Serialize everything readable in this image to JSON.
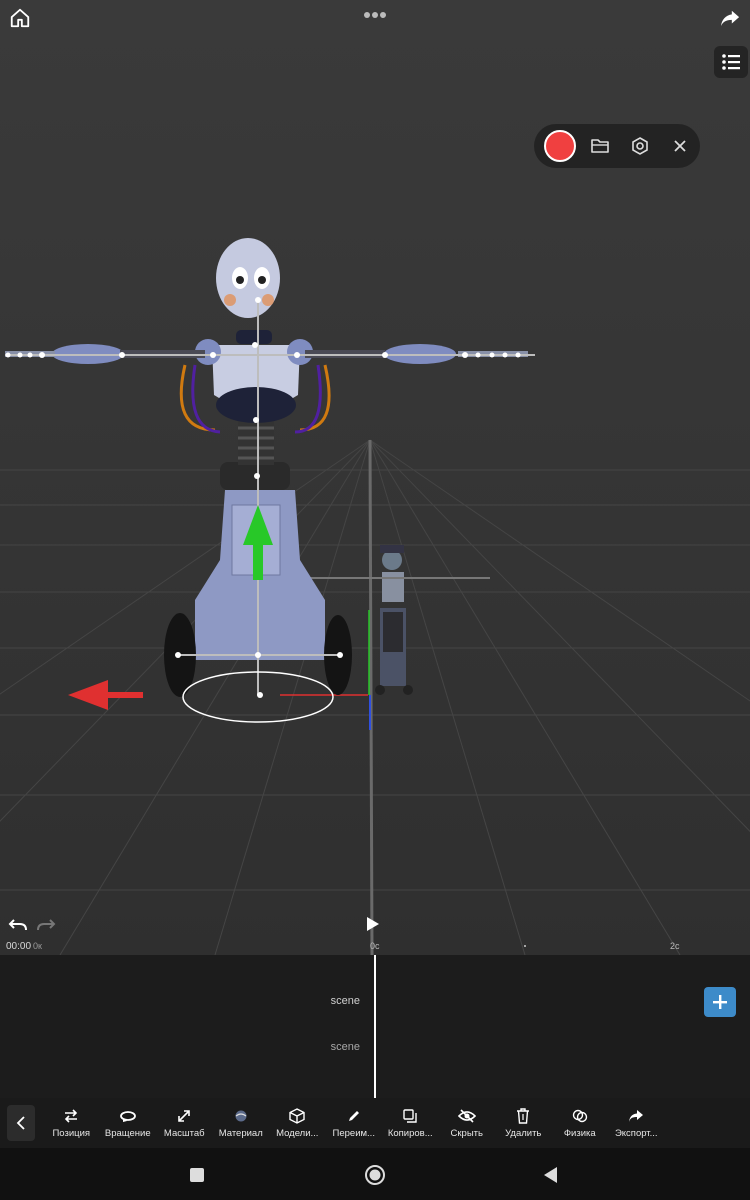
{
  "app": {
    "top_bar": {
      "home": "home-icon",
      "more": "more-horizontal-icon",
      "share": "share-icon",
      "layers": "list-icon"
    },
    "record_bar": {
      "record": "record-icon",
      "folder": "folder-icon",
      "settings": "settings-icon",
      "close": "close-icon",
      "record_color": "#f04040"
    }
  },
  "timeline": {
    "time": "00:00",
    "time_sub": "0к",
    "tick_start": "0с",
    "tick_end": "2с",
    "tracks": [
      {
        "label": "scene"
      },
      {
        "label": "scene"
      }
    ],
    "add_icon": "plus-icon",
    "accent": "#3d8bc9"
  },
  "toolbar": {
    "tools": [
      {
        "label": "Позиция",
        "icon": "move-icon"
      },
      {
        "label": "Вращение",
        "icon": "rotate-icon"
      },
      {
        "label": "Масштаб",
        "icon": "scale-icon"
      },
      {
        "label": "Материал",
        "icon": "material-icon"
      },
      {
        "label": "Модели...",
        "icon": "cube-icon"
      },
      {
        "label": "Переим...",
        "icon": "pencil-icon"
      },
      {
        "label": "Копиров...",
        "icon": "copy-icon"
      },
      {
        "label": "Скрыть",
        "icon": "eye-off-icon"
      },
      {
        "label": "Удалить",
        "icon": "trash-icon"
      },
      {
        "label": "Физика",
        "icon": "physics-icon"
      },
      {
        "label": "Экспорт...",
        "icon": "export-icon"
      }
    ]
  },
  "colors": {
    "axis_x": "#e03030",
    "axis_y": "#28c828",
    "axis_z": "#3050e0"
  }
}
